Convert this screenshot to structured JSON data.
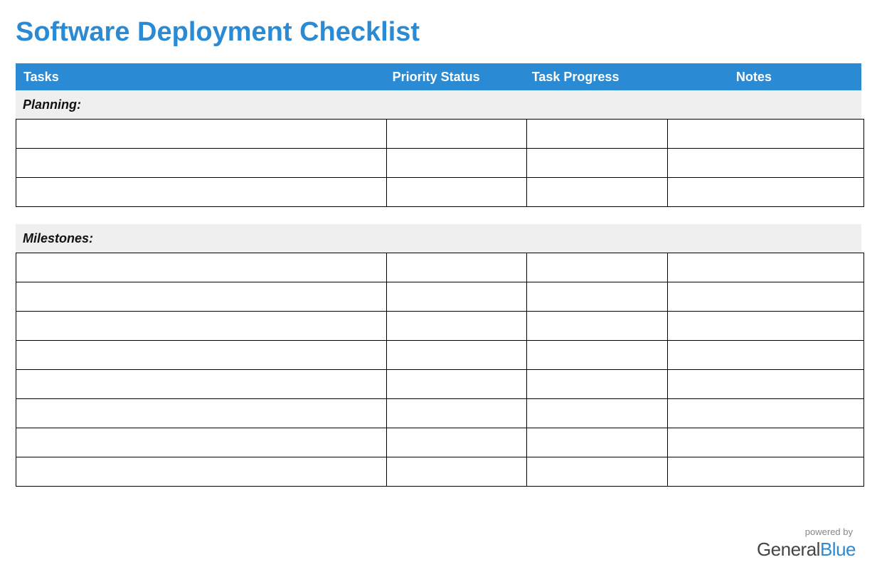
{
  "title": "Software Deployment Checklist",
  "columns": {
    "tasks": "Tasks",
    "priority": "Priority Status",
    "progress": "Task Progress",
    "notes": "Notes"
  },
  "sections": [
    {
      "label": "Planning:",
      "row_count": 3
    },
    {
      "label": "Milestones:",
      "row_count": 8
    }
  ],
  "footer": {
    "powered_by": "powered by",
    "brand_part1": "General",
    "brand_part2": "Blue"
  },
  "colors": {
    "accent": "#2a8ad4",
    "section_bg": "#efefef"
  }
}
